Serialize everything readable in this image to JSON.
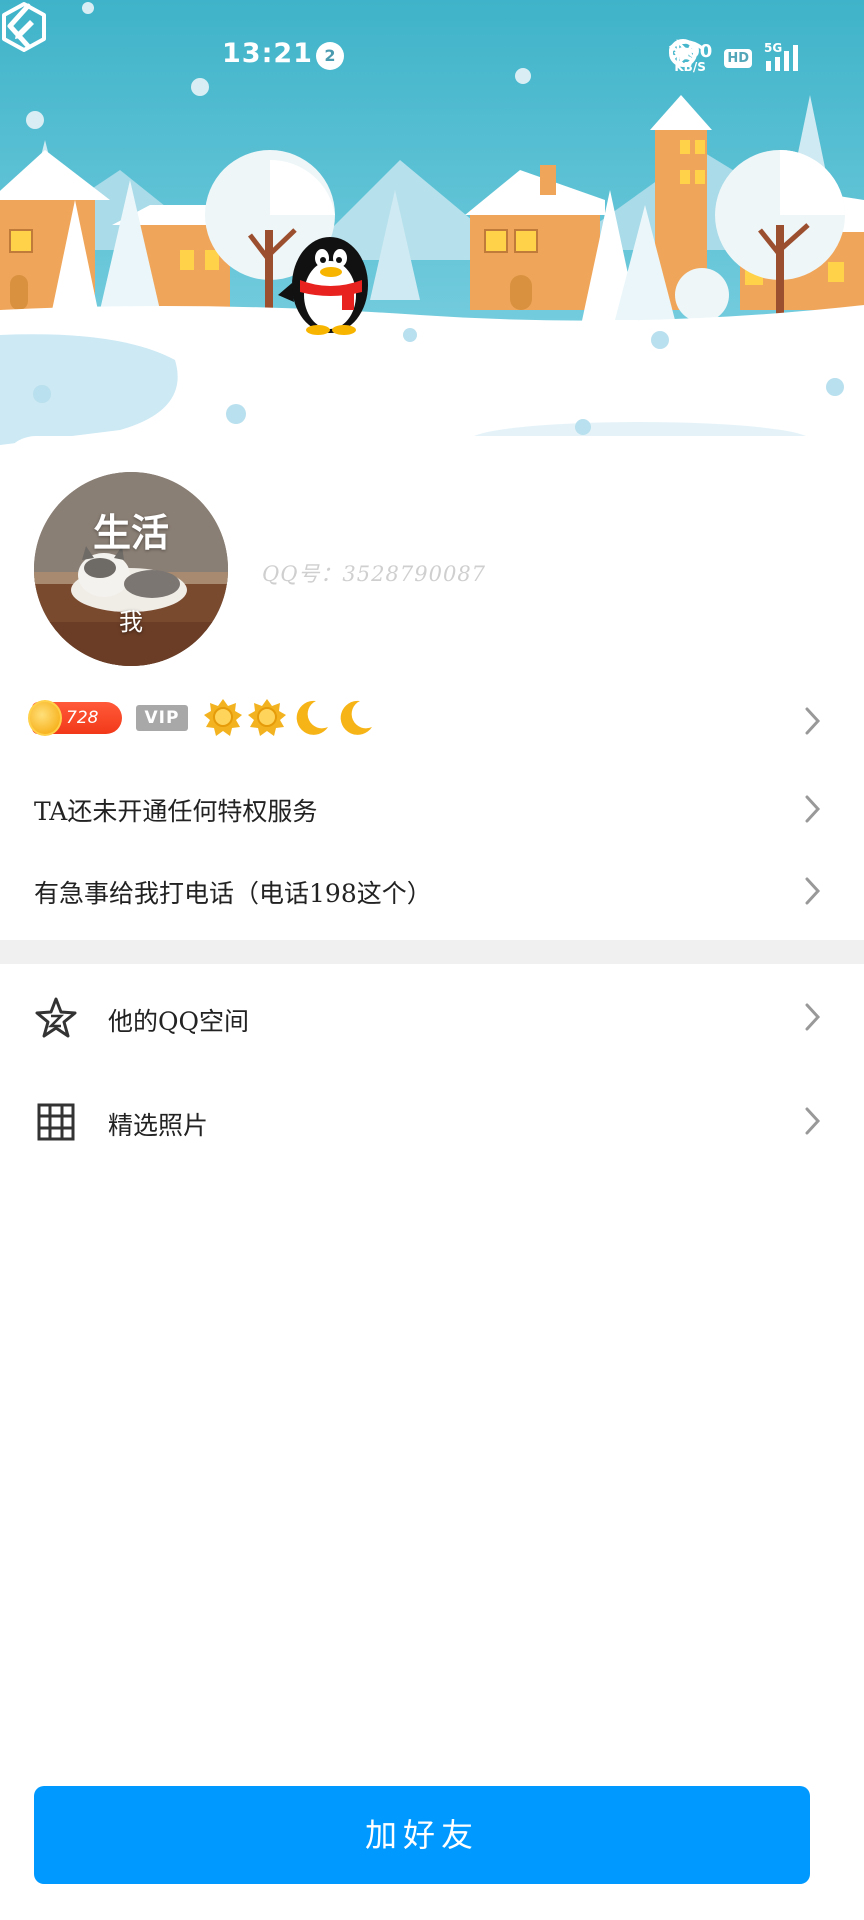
{
  "status_bar": {
    "time": "13:21",
    "notification_count": "2",
    "net_speed_value": "6.00",
    "net_speed_unit": "KB/S",
    "hd_label": "HD",
    "network_type": "5G"
  },
  "profile": {
    "avatar_top_text": "生活",
    "avatar_bottom_text": "我",
    "qq_number_label": "QQ号：3528790087",
    "coin_value": "728",
    "vip_label": "VIP",
    "level_icons": [
      "sun-icon",
      "sun-icon",
      "moon-icon",
      "moon-icon"
    ]
  },
  "rows": {
    "privilege": "TA还未开通任何特权服务",
    "signature": "有急事给我打电话（电话198这个）"
  },
  "menu": [
    {
      "label": "他的QQ空间",
      "icon": "qzone-star-icon"
    },
    {
      "label": "精选照片",
      "icon": "grid-icon"
    }
  ],
  "actions": {
    "add_friend": "加好友"
  },
  "colors": {
    "primary_button": "#0099ff",
    "sky_top": "#3fb3c9",
    "coin_red": "#f2391a"
  }
}
